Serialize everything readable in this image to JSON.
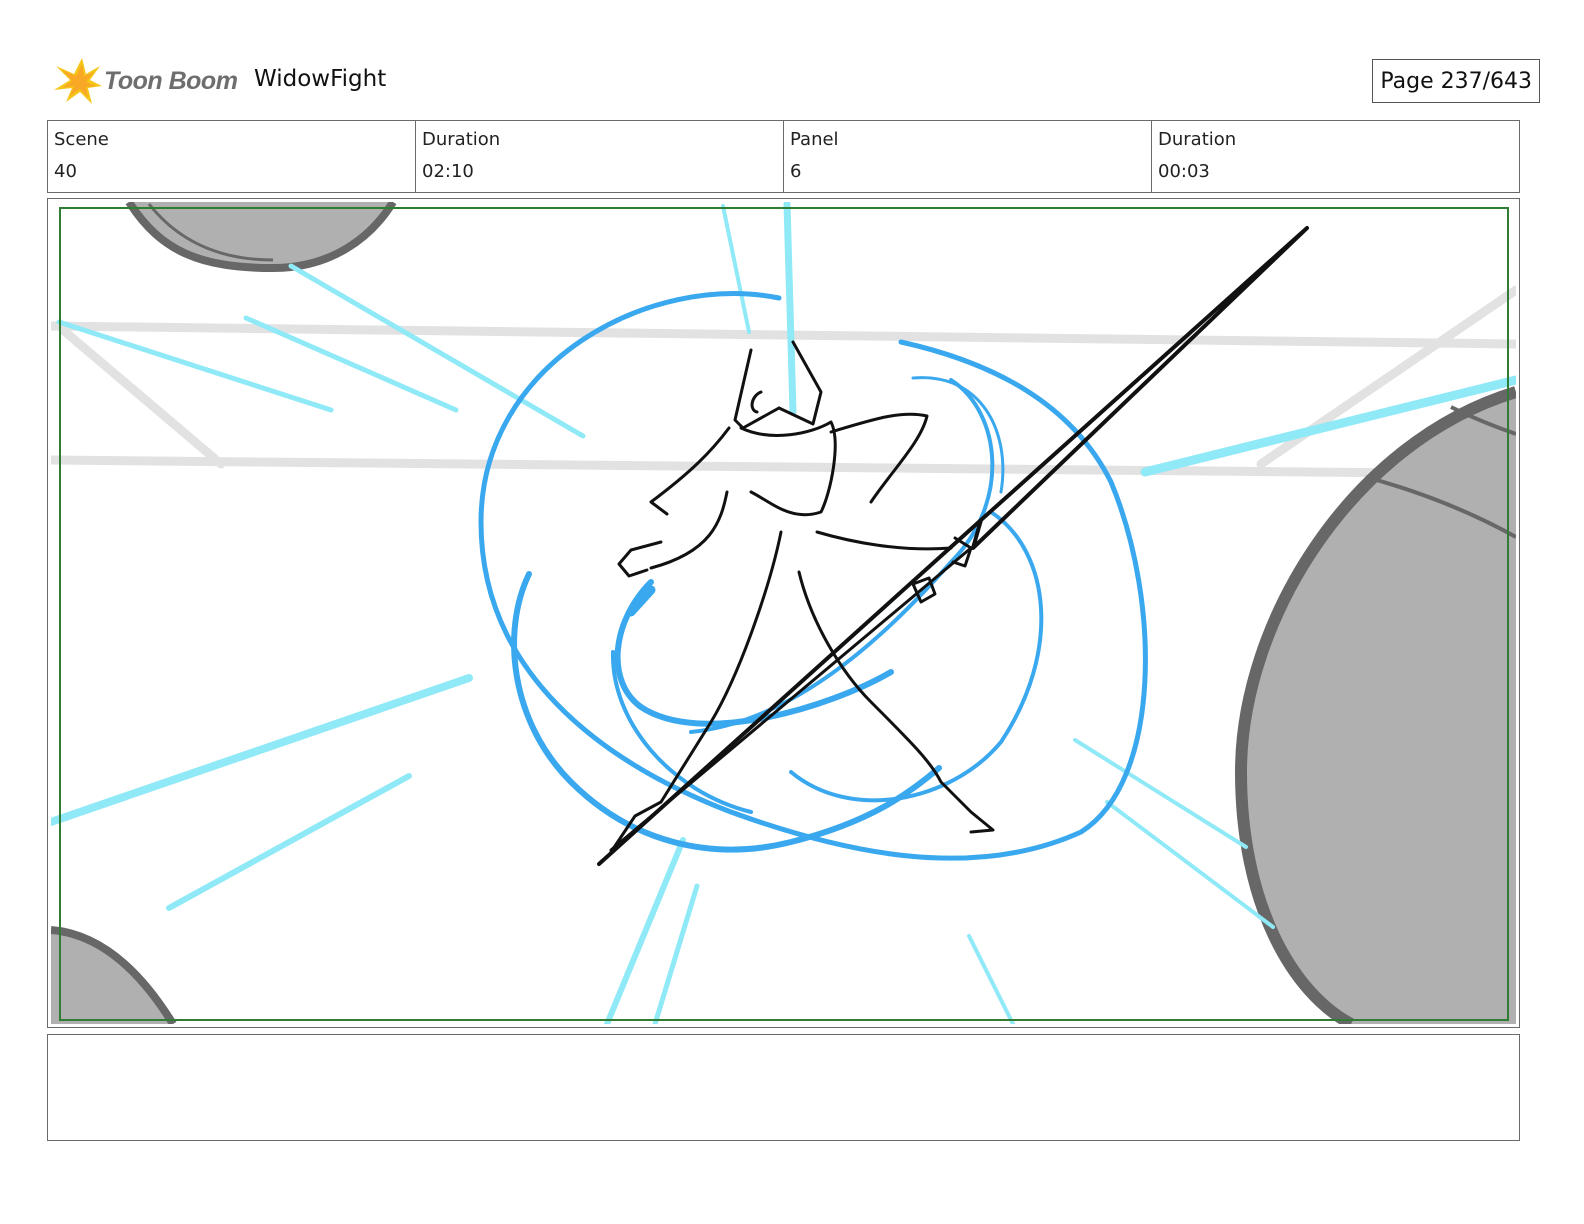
{
  "header": {
    "logo_text": "Toon Boom",
    "project_title": "WidowFight",
    "page_label": "Page 237/643"
  },
  "info": {
    "scene_label": "Scene",
    "scene_value": "40",
    "scene_duration_label": "Duration",
    "scene_duration_value": "02:10",
    "panel_label": "Panel",
    "panel_value": "6",
    "panel_duration_label": "Duration",
    "panel_duration_value": "00:03"
  },
  "colors": {
    "swirl_blue": "#3aa8ee",
    "speed_line_cyan": "#8fe9f7",
    "planet_fill": "#b0b0b0",
    "planet_outline": "#676767",
    "safe_area_green": "#2e7d32",
    "logo_yellow": "#f5c518"
  },
  "icons": {
    "logo": "toon-boom-star-icon"
  },
  "caption": {
    "text": ""
  }
}
